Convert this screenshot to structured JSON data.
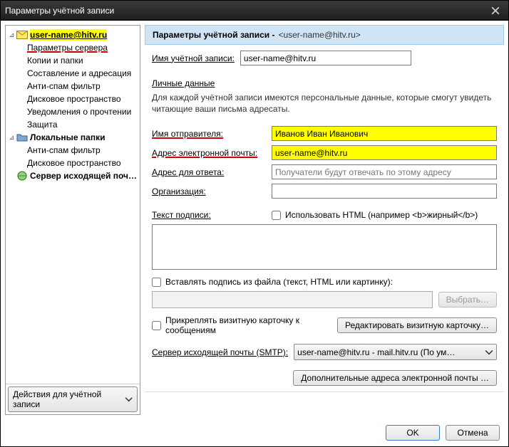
{
  "window": {
    "title": "Параметры учётной записи"
  },
  "sidebar": {
    "account": "user-name@hitv.ru",
    "items": {
      "server_params": "Параметры сервера",
      "copies": "Копии и папки",
      "compose": "Составление и адресация",
      "antispam": "Анти-спам фильтр",
      "disk": "Дисковое пространство",
      "receipts": "Уведомления о прочтении",
      "security": "Защита"
    },
    "local_folders": "Локальные папки",
    "local_items": {
      "antispam": "Анти-спам фильтр",
      "disk": "Дисковое пространство"
    },
    "smtp": "Сервер исходящей поч…",
    "action_button": "Действия для учётной записи"
  },
  "header": {
    "title": "Параметры учётной записи -",
    "subtitle": "<user-name@hitv.ru>"
  },
  "form": {
    "account_name_label": "Имя учётной записи:",
    "account_name_value": "user-name@hitv.ru",
    "personal_section": "Личные данные",
    "personal_desc": "Для каждой учётной записи имеются персональные данные, которые смогут увидеть читающие ваши письма адресаты.",
    "sender_name_label": "Имя отправителя:",
    "sender_name_value": "Иванов Иван Иванович",
    "email_label": "Адрес электронной почты:",
    "email_value": "user-name@hitv.ru",
    "replyto_label": "Адрес для ответа:",
    "replyto_placeholder": "Получатели будут отвечать по этому адресу",
    "org_label": "Организация:",
    "sig_label": "Текст подписи:",
    "sig_html_chk": "Использовать HTML (например <b>жирный</b>)",
    "sig_file_chk": "Вставлять подпись из файла (текст, HTML или картинку):",
    "choose_btn": "Выбрать…",
    "vcard_chk": "Прикреплять визитную карточку к сообщениям",
    "vcard_btn": "Редактировать визитную карточку…",
    "smtp_label": "Сервер исходящей почты (SMTP):",
    "smtp_value": "user-name@hitv.ru - mail.hitv.ru       (По ум…",
    "extra_addr_btn": "Дополнительные адреса электронной почты …"
  },
  "buttons": {
    "ok": "OK",
    "cancel": "Отмена"
  }
}
